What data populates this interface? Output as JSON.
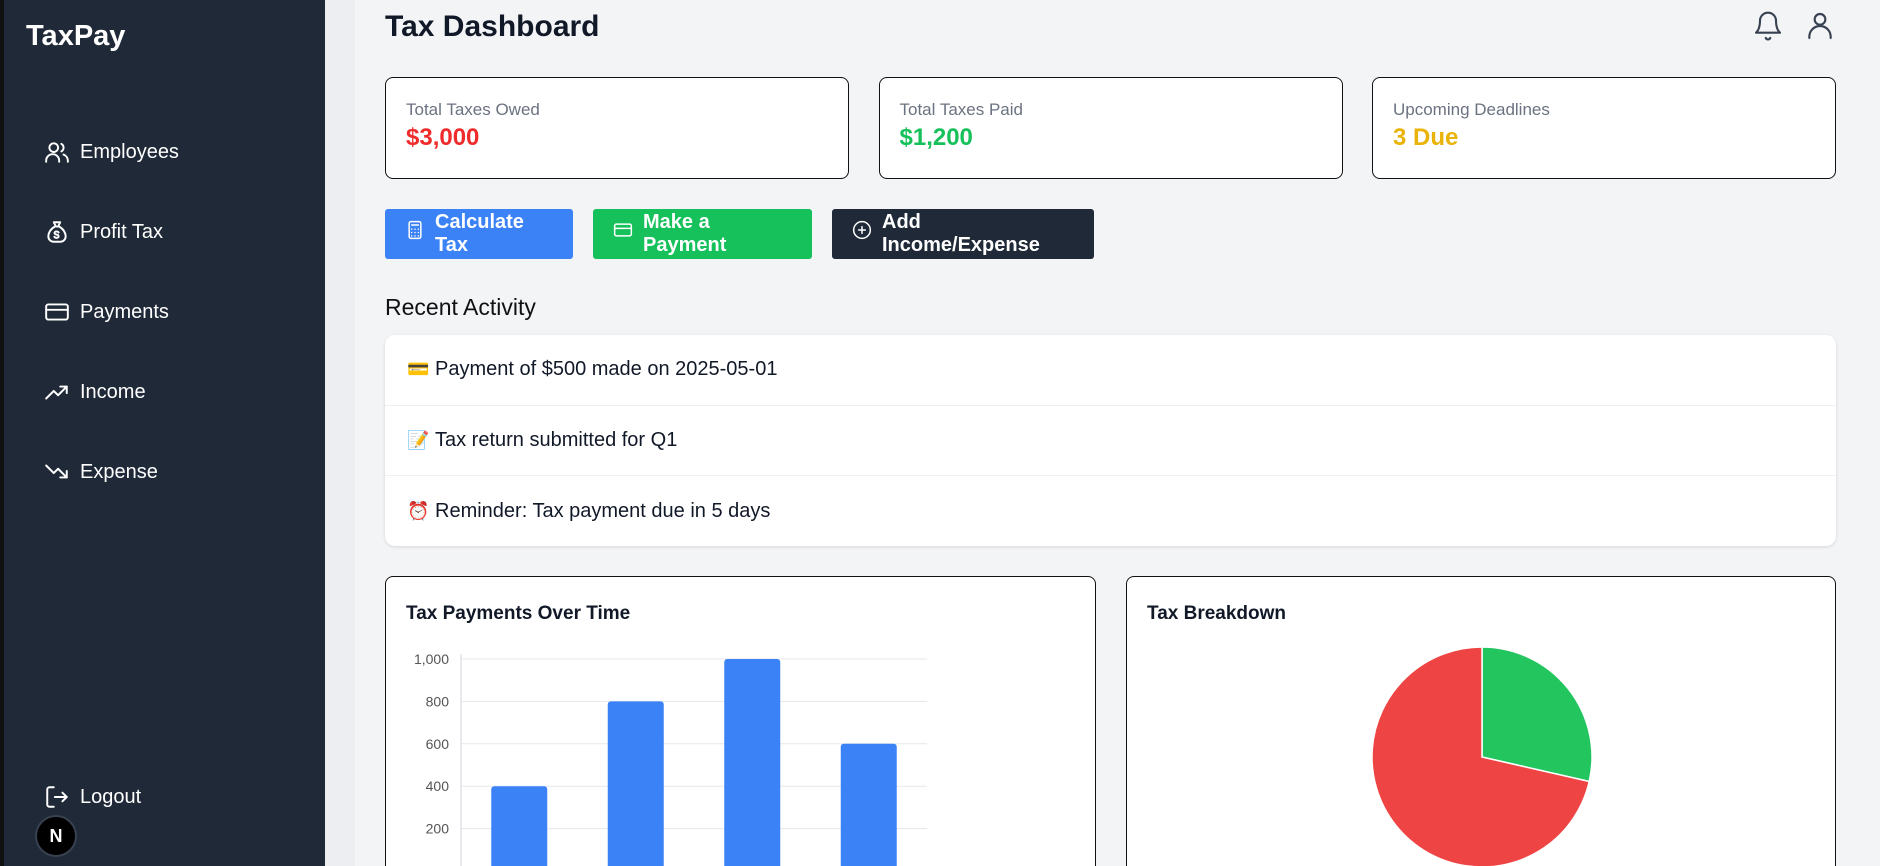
{
  "app": {
    "brand": "TaxPay",
    "avatar_letter": "N"
  },
  "sidebar": {
    "items": [
      {
        "label": "Employees",
        "icon": "users-icon"
      },
      {
        "label": "Profit Tax",
        "icon": "money-bag-icon"
      },
      {
        "label": "Payments",
        "icon": "credit-card-icon"
      },
      {
        "label": "Income",
        "icon": "trending-up-icon"
      },
      {
        "label": "Expense",
        "icon": "trending-down-icon"
      }
    ],
    "logout_label": "Logout"
  },
  "header": {
    "title": "Tax Dashboard",
    "icons": [
      "bell-icon",
      "user-icon"
    ]
  },
  "cards": [
    {
      "label": "Total Taxes Owed",
      "value": "$3,000",
      "color": "#ef2b2b"
    },
    {
      "label": "Total Taxes Paid",
      "value": "$1,200",
      "color": "#16c05a"
    },
    {
      "label": "Upcoming Deadlines",
      "value": "3 Due",
      "color": "#eab308"
    }
  ],
  "actions": {
    "calculate": "Calculate Tax",
    "payment": "Make a Payment",
    "add": "Add Income/Expense"
  },
  "activity": {
    "title": "Recent Activity",
    "items": [
      {
        "emoji": "💳",
        "text": "Payment of $500 made on 2025-05-01"
      },
      {
        "emoji": "📝",
        "text": "Tax return submitted for Q1"
      },
      {
        "emoji": "⏰",
        "text": "Reminder: Tax payment due in 5 days"
      }
    ]
  },
  "colors": {
    "sidebar": "#1f2937",
    "blue": "#3b82f6",
    "green": "#16c05a",
    "red": "#ef4444",
    "dark": "#1f2937"
  },
  "chart_data": [
    {
      "type": "bar",
      "title": "Tax Payments Over Time",
      "values": [
        400,
        800,
        1000,
        600
      ],
      "ylim": [
        0,
        1000
      ],
      "yticks": [
        "1,000",
        "800",
        "600",
        "400",
        "200"
      ],
      "grid": true,
      "color": "#3b82f6"
    },
    {
      "type": "pie",
      "title": "Tax Breakdown",
      "values": [
        1200,
        3000
      ],
      "colors": [
        "#22c55e",
        "#ef4444"
      ]
    }
  ]
}
